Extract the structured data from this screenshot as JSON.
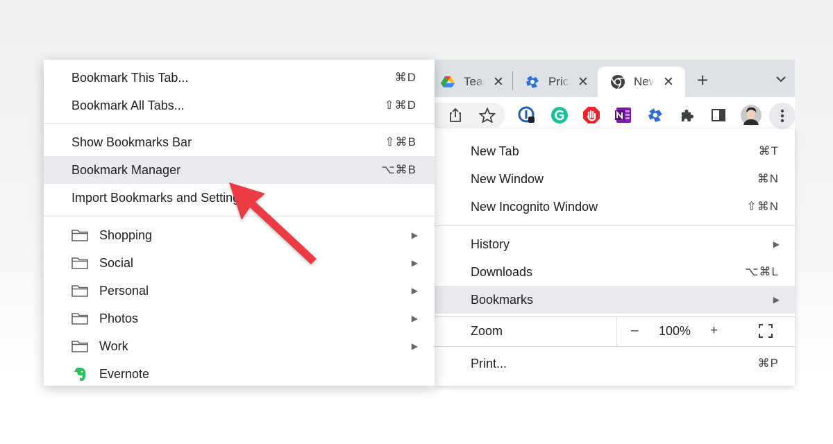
{
  "tabs": [
    {
      "title": "Team"
    },
    {
      "title": "Pricing"
    },
    {
      "title": "New Tab"
    }
  ],
  "main_menu": {
    "items": [
      {
        "label": "New Tab",
        "shortcut": "⌘T"
      },
      {
        "label": "New Window",
        "shortcut": "⌘N"
      },
      {
        "label": "New Incognito Window",
        "shortcut": "⇧⌘N"
      },
      {
        "label": "History"
      },
      {
        "label": "Downloads",
        "shortcut": "⌥⌘L"
      },
      {
        "label": "Bookmarks"
      },
      {
        "label": "Print...",
        "shortcut": "⌘P"
      }
    ],
    "zoom": {
      "label": "Zoom",
      "minus": "–",
      "value": "100%",
      "plus": "+"
    }
  },
  "bookmarks_menu": {
    "actions": [
      {
        "label": "Bookmark This Tab...",
        "shortcut": "⌘D"
      },
      {
        "label": "Bookmark All Tabs...",
        "shortcut": "⇧⌘D"
      },
      {
        "label": "Show Bookmarks Bar",
        "shortcut": "⇧⌘B"
      },
      {
        "label": "Bookmark Manager",
        "shortcut": "⌥⌘B"
      },
      {
        "label": "Import Bookmarks and Settings..."
      }
    ],
    "folders": [
      {
        "label": "Shopping"
      },
      {
        "label": "Social"
      },
      {
        "label": "Personal"
      },
      {
        "label": "Photos"
      },
      {
        "label": "Work"
      }
    ],
    "evernote": {
      "label": "Evernote"
    }
  },
  "colors": {
    "arrow": "#ec3b45",
    "highlight": "#e8eaed",
    "tabstrip": "#dee1e6"
  }
}
